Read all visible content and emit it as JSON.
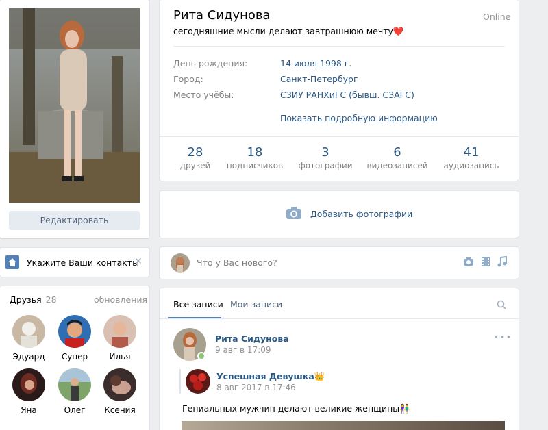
{
  "profile": {
    "name": "Рита Сидунова",
    "online": "Online",
    "status": "сегодняшние мысли делают завтрашнюю мечту❤️",
    "edit_label": "Редактировать"
  },
  "info": {
    "rows": [
      {
        "key": "День рождения:",
        "value": "14 июля 1998 г."
      },
      {
        "key": "Город:",
        "value": "Санкт-Петербург"
      },
      {
        "key": "Место учёбы:",
        "value": "СЗИУ РАНХиГС (бывш. СЗАГС)"
      }
    ],
    "more_label": "Показать подробную информацию"
  },
  "stats": [
    {
      "count": "28",
      "label": "друзей"
    },
    {
      "count": "18",
      "label": "подписчиков"
    },
    {
      "count": "3",
      "label": "фотографии"
    },
    {
      "count": "6",
      "label": "видеозаписей"
    },
    {
      "count": "41",
      "label": "аудиозапись"
    }
  ],
  "add_photo_label": "Добавить фотографии",
  "contacts": {
    "label": "Укажите Ваши контакты",
    "close": "✕"
  },
  "friends": {
    "title": "Друзья",
    "count": "28",
    "updates": "обновления",
    "items": [
      {
        "name": "Эдуард"
      },
      {
        "name": "Супер"
      },
      {
        "name": "Илья"
      },
      {
        "name": "Яна"
      },
      {
        "name": "Олег"
      },
      {
        "name": "Ксения"
      }
    ]
  },
  "new_post": {
    "placeholder": "Что у Вас нового?"
  },
  "wall": {
    "tab_all": "Все записи",
    "tab_my": "Мои записи",
    "post": {
      "author": "Рита Сидунова",
      "date": "9 авг в 17:09",
      "menu": "•••",
      "repost_author": "Успешная Девушка👑",
      "repost_date": "8 авг 2017 в 17:46",
      "text": "Гениальных мужчин делают великие женщины👫"
    }
  },
  "colors": {
    "link": "#2a5885",
    "accent": "#5181b8",
    "background": "#edeef0",
    "online_dot": "#8ac176"
  }
}
